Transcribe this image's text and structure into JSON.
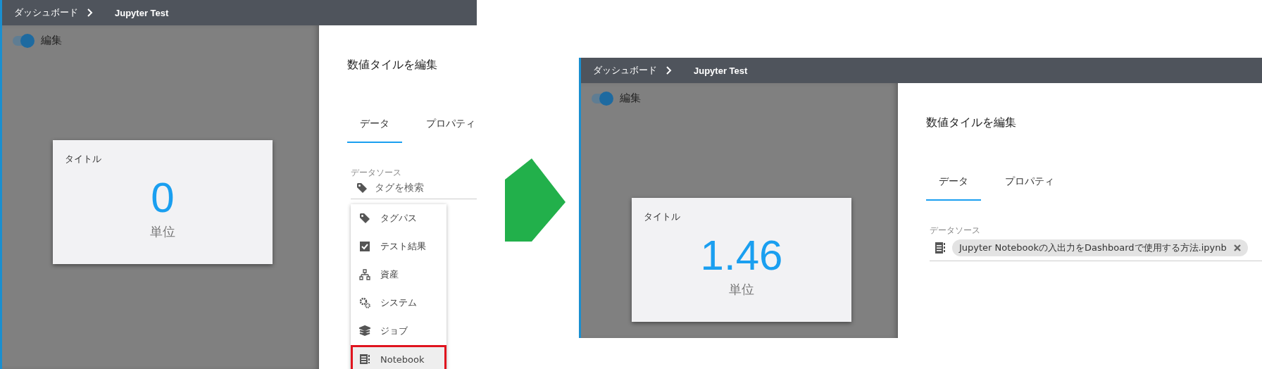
{
  "screens": [
    {
      "breadcrumb": [
        "ダッシュボード",
        "Jupyter Test"
      ],
      "edit_toggle": {
        "label": "編集",
        "on": true
      },
      "tile": {
        "title": "タイトル",
        "value": "0",
        "unit": "単位"
      },
      "panel": {
        "title": "数値タイルを編集",
        "tabs": [
          {
            "label": "データ",
            "selected": true
          },
          {
            "label": "プロパティ",
            "selected": false
          }
        ],
        "source_label": "データソース",
        "search": {
          "placeholder": "タグを検索"
        },
        "menu": [
          {
            "label": "タグパス",
            "selected": false
          },
          {
            "label": "テスト結果",
            "selected": false
          },
          {
            "label": "資産",
            "selected": false
          },
          {
            "label": "システム",
            "selected": false
          },
          {
            "label": "ジョブ",
            "selected": false
          },
          {
            "label": "Notebook",
            "selected": true
          }
        ]
      }
    },
    {
      "breadcrumb": [
        "ダッシュボード",
        "Jupyter Test"
      ],
      "edit_toggle": {
        "label": "編集",
        "on": true
      },
      "tile": {
        "title": "タイトル",
        "value": "1.46",
        "unit": "単位"
      },
      "panel": {
        "title": "数値タイルを編集",
        "tabs": [
          {
            "label": "データ",
            "selected": true
          },
          {
            "label": "プロパティ",
            "selected": false
          }
        ],
        "source_label": "データソース",
        "chip": {
          "label": "Jupyter Notebookの入出力をDashboardで使用する方法.ipynb"
        }
      }
    }
  ]
}
